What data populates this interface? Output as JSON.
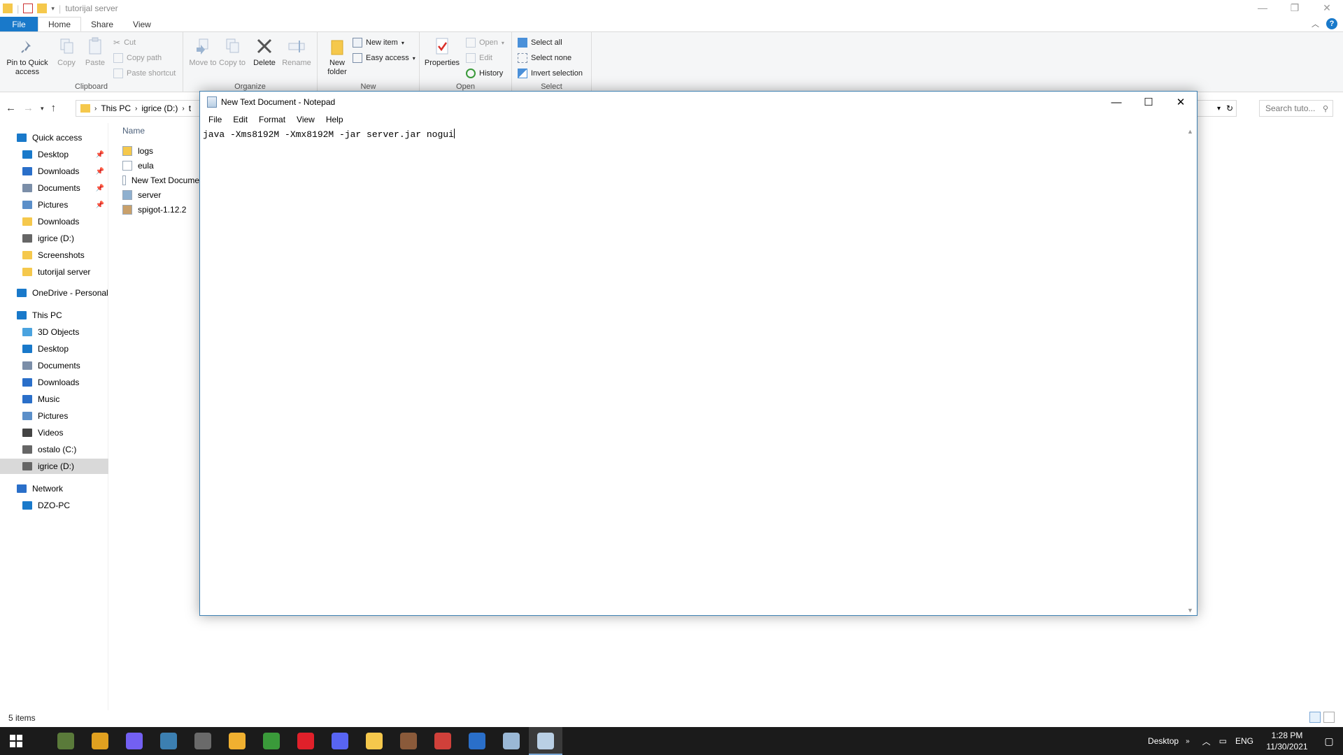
{
  "explorer": {
    "title": "tutorijal server",
    "tabs": [
      "File",
      "Home",
      "Share",
      "View"
    ],
    "active_tab": "Home",
    "ribbon": {
      "clipboard": {
        "label": "Clipboard",
        "pin": "Pin to Quick access",
        "copy": "Copy",
        "paste": "Paste",
        "cut": "Cut",
        "copy_path": "Copy path",
        "paste_shortcut": "Paste shortcut"
      },
      "organize": {
        "label": "Organize",
        "move_to": "Move to",
        "copy_to": "Copy to",
        "delete": "Delete",
        "rename": "Rename"
      },
      "new": {
        "label": "New",
        "new_folder": "New folder",
        "new_item": "New item",
        "easy_access": "Easy access"
      },
      "open": {
        "label": "Open",
        "properties": "Properties",
        "open": "Open",
        "edit": "Edit",
        "history": "History"
      },
      "select": {
        "label": "Select",
        "select_all": "Select all",
        "select_none": "Select none",
        "invert": "Invert selection"
      }
    },
    "address": [
      "This PC",
      "igrice (D:)",
      "t"
    ],
    "search_placeholder": "Search tuto...",
    "nav": [
      {
        "label": "Quick access",
        "icon": "star-icon",
        "color": "#1979ca"
      },
      {
        "label": "Desktop",
        "icon": "desktop-icon",
        "color": "#1979ca",
        "pinned": true
      },
      {
        "label": "Downloads",
        "icon": "download-icon",
        "color": "#2a6fc9",
        "pinned": true
      },
      {
        "label": "Documents",
        "icon": "documents-icon",
        "color": "#7b8ea8",
        "pinned": true
      },
      {
        "label": "Pictures",
        "icon": "pictures-icon",
        "color": "#5b8fc9",
        "pinned": true
      },
      {
        "label": "Downloads",
        "icon": "folder-icon",
        "color": "#f5c84c"
      },
      {
        "label": "igrice (D:)",
        "icon": "drive-icon",
        "color": "#666"
      },
      {
        "label": "Screenshots",
        "icon": "folder-icon",
        "color": "#f5c84c"
      },
      {
        "label": "tutorijal server",
        "icon": "folder-icon",
        "color": "#f5c84c"
      },
      {
        "label": "OneDrive - Personal",
        "icon": "onedrive-icon",
        "color": "#1979ca"
      },
      {
        "label": "This PC",
        "icon": "pc-icon",
        "color": "#1979ca"
      },
      {
        "label": "3D Objects",
        "icon": "3d-objects-icon",
        "color": "#4aa3df"
      },
      {
        "label": "Desktop",
        "icon": "desktop-icon",
        "color": "#1979ca"
      },
      {
        "label": "Documents",
        "icon": "documents-icon",
        "color": "#7b8ea8"
      },
      {
        "label": "Downloads",
        "icon": "download-icon",
        "color": "#2a6fc9"
      },
      {
        "label": "Music",
        "icon": "music-icon",
        "color": "#2a6fc9"
      },
      {
        "label": "Pictures",
        "icon": "pictures-icon",
        "color": "#5b8fc9"
      },
      {
        "label": "Videos",
        "icon": "videos-icon",
        "color": "#444"
      },
      {
        "label": "ostalo (C:)",
        "icon": "drive-icon",
        "color": "#666"
      },
      {
        "label": "igrice (D:)",
        "icon": "drive-icon",
        "color": "#666",
        "selected": true
      },
      {
        "label": "Network",
        "icon": "network-icon",
        "color": "#2a6fc9"
      },
      {
        "label": "DZO-PC",
        "icon": "pc-icon",
        "color": "#1979ca"
      }
    ],
    "column_name": "Name",
    "files": [
      {
        "name": "logs",
        "icon": "folder-icon",
        "color": "#f5c84c"
      },
      {
        "name": "eula",
        "icon": "text-file-icon",
        "color": "#ffffff"
      },
      {
        "name": "New Text Document",
        "icon": "text-file-icon",
        "color": "#ffffff"
      },
      {
        "name": "server",
        "icon": "jar-icon",
        "color": "#8fb0cf"
      },
      {
        "name": "spigot-1.12.2",
        "icon": "jar-icon",
        "color": "#c9a06a"
      }
    ],
    "status": "5 items"
  },
  "notepad": {
    "title": "New Text Document - Notepad",
    "menu": [
      "File",
      "Edit",
      "Format",
      "View",
      "Help"
    ],
    "content": "java -Xms8192M -Xmx8192M -jar server.jar nogui"
  },
  "taskbar": {
    "apps": [
      {
        "name": "minecraft-icon",
        "color": "#5a7a3a"
      },
      {
        "name": "chrome-icon",
        "color": "#e0a020"
      },
      {
        "name": "viber-icon",
        "color": "#7360f2"
      },
      {
        "name": "calculator-icon",
        "color": "#3c7fb1"
      },
      {
        "name": "game-icon",
        "color": "#6a6a6a"
      },
      {
        "name": "chrome-canary-icon",
        "color": "#f0b030"
      },
      {
        "name": "vim-icon",
        "color": "#3a9a3a"
      },
      {
        "name": "opera-icon",
        "color": "#e0202a"
      },
      {
        "name": "discord-icon",
        "color": "#5865f2"
      },
      {
        "name": "file-explorer-icon",
        "color": "#f5c84c"
      },
      {
        "name": "game-character-icon",
        "color": "#8a5a3a"
      },
      {
        "name": "chrome-alt-icon",
        "color": "#d0403a"
      },
      {
        "name": "photos-icon",
        "color": "#2a6fc9"
      },
      {
        "name": "paint-icon",
        "color": "#9ab8d6"
      },
      {
        "name": "notepad-icon",
        "color": "#b9cfe4"
      }
    ],
    "desktop_label": "Desktop",
    "language": "ENG",
    "time": "1:28 PM",
    "date": "11/30/2021"
  }
}
